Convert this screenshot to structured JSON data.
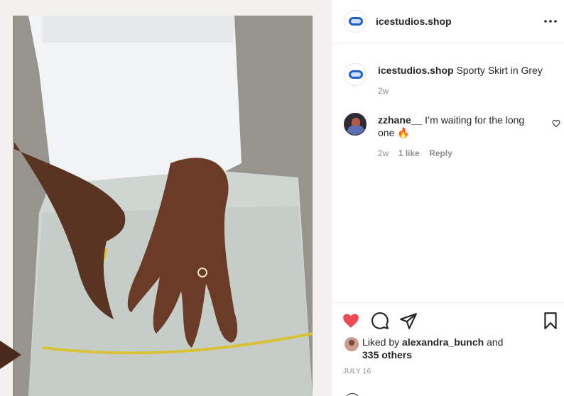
{
  "post": {
    "account": "icestudios.shop"
  },
  "caption": {
    "username": "icestudios.shop",
    "text": " Sporty Skirt in Grey",
    "age": "2w"
  },
  "comment": {
    "username": "zzhane__",
    "text": " I’m waiting for the long one 🔥",
    "age": "2w",
    "likes": "1 like",
    "reply": "Reply"
  },
  "likes": {
    "prefix": "Liked by ",
    "user": "alexandra_bunch",
    "middle": " and",
    "others": "335 others"
  },
  "date": "JULY 16",
  "colors": {
    "like_active": "#ed4956",
    "brand_blue": "#1f5fc9"
  },
  "icons": [
    "more-options-icon",
    "heart-icon",
    "comment-icon",
    "share-icon",
    "bookmark-icon",
    "heart-outline-icon"
  ]
}
